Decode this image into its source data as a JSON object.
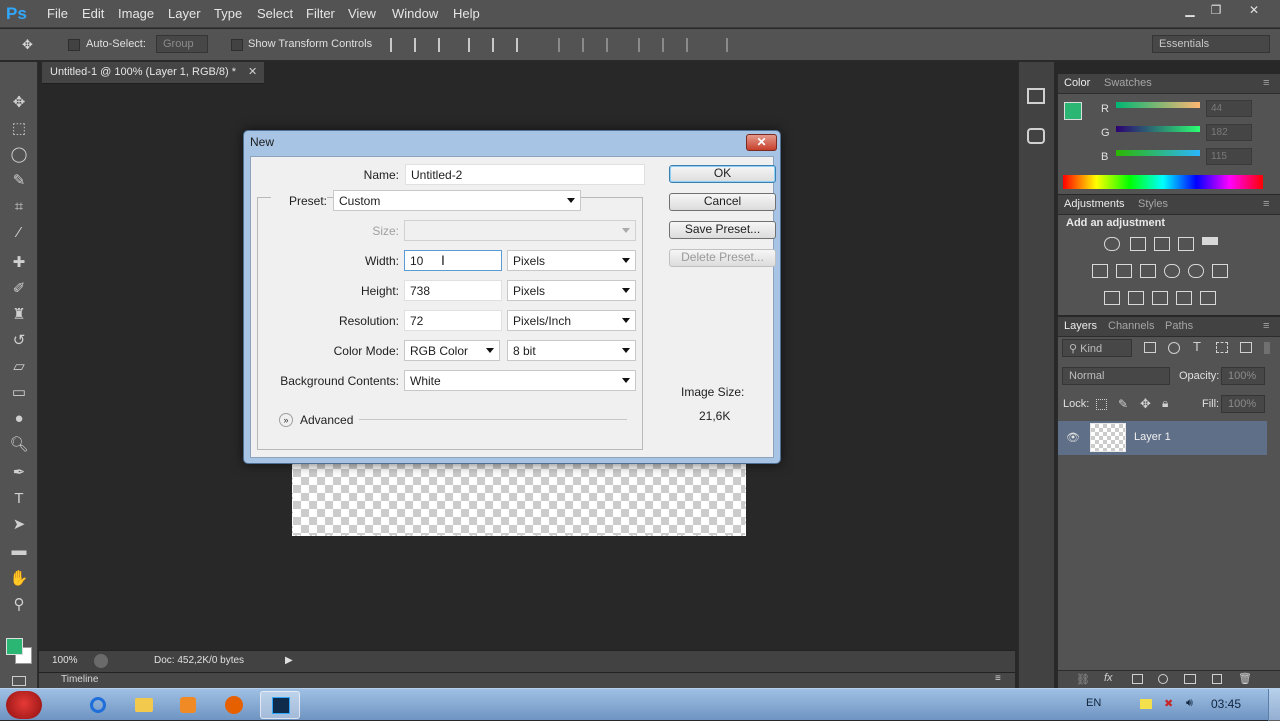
{
  "menubar": {
    "logo": "Ps",
    "items": [
      "File",
      "Edit",
      "Image",
      "Layer",
      "Type",
      "Select",
      "Filter",
      "View",
      "Window",
      "Help"
    ]
  },
  "options": {
    "auto_select_label": "Auto-Select:",
    "auto_select_value": "Group",
    "transform_label": "Show Transform Controls",
    "workspace": "Essentials"
  },
  "document": {
    "tab_title": "Untitled-1 @ 100% (Layer 1, RGB/8) *",
    "zoom": "100%",
    "doc_info": "Doc: 452,2K/0 bytes",
    "timeline_label": "Timeline"
  },
  "dialog": {
    "title": "New",
    "name_label": "Name:",
    "name_value": "Untitled-2",
    "preset_label": "Preset:",
    "preset_value": "Custom",
    "size_label": "Size:",
    "width_label": "Width:",
    "width_value": "10",
    "width_unit": "Pixels",
    "height_label": "Height:",
    "height_value": "738",
    "height_unit": "Pixels",
    "resolution_label": "Resolution:",
    "resolution_value": "72",
    "resolution_unit": "Pixels/Inch",
    "color_mode_label": "Color Mode:",
    "color_mode_value": "RGB Color",
    "bit_depth": "8 bit",
    "background_label": "Background Contents:",
    "background_value": "White",
    "advanced_label": "Advanced",
    "ok": "OK",
    "cancel": "Cancel",
    "save_preset": "Save Preset...",
    "delete_preset": "Delete Preset...",
    "image_size_label": "Image Size:",
    "image_size_value": "21,6K"
  },
  "color_panel": {
    "tabs": [
      "Color",
      "Swatches"
    ],
    "r_label": "R",
    "g_label": "G",
    "b_label": "B",
    "r": "44",
    "g": "182",
    "b": "115",
    "swatch_color": "#2cb673"
  },
  "adjustments_panel": {
    "tabs": [
      "Adjustments",
      "Styles"
    ],
    "heading": "Add an adjustment"
  },
  "layers_panel": {
    "tabs": [
      "Layers",
      "Channels",
      "Paths"
    ],
    "kind": "Kind",
    "blend_mode": "Normal",
    "opacity_label": "Opacity:",
    "opacity_value": "100%",
    "lock_label": "Lock:",
    "fill_label": "Fill:",
    "fill_value": "100%",
    "layers": [
      {
        "name": "Layer 1"
      }
    ]
  },
  "taskbar": {
    "language": "EN",
    "clock": "03:45"
  }
}
